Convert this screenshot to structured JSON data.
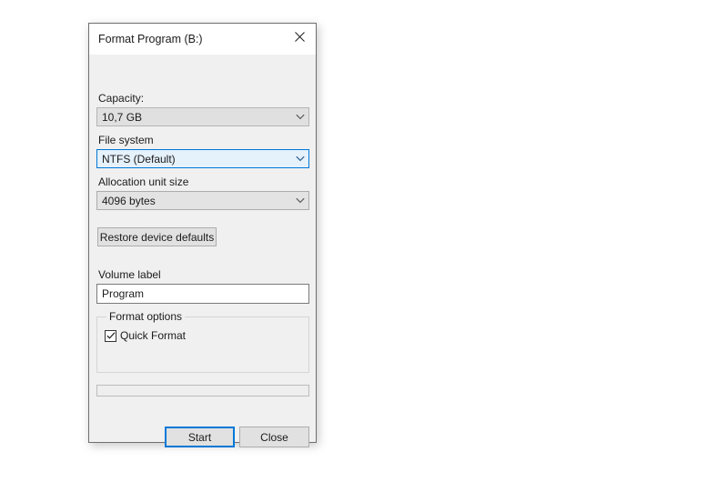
{
  "dialog": {
    "title": "Format Program (B:)",
    "close_icon": "close-icon"
  },
  "capacity": {
    "label": "Capacity:",
    "value": "10,7 GB",
    "arrow_icon": "chevron-down-icon"
  },
  "file_system": {
    "label": "File system",
    "value": "NTFS (Default)",
    "arrow_icon": "chevron-down-icon"
  },
  "allocation_unit": {
    "label": "Allocation unit size",
    "value": "4096 bytes",
    "arrow_icon": "chevron-down-icon"
  },
  "restore_defaults": {
    "label": "Restore device defaults"
  },
  "volume_label": {
    "label": "Volume label",
    "value": "Program",
    "placeholder": ""
  },
  "format_options": {
    "legend": "Format options",
    "quick_format": {
      "label": "Quick Format",
      "checked": true,
      "check_icon": "checkmark-icon"
    }
  },
  "progress": {
    "percent": 0
  },
  "buttons": {
    "start": "Start",
    "close": "Close"
  },
  "colors": {
    "accent": "#0078d7",
    "dialog_bg": "#f0f0f0",
    "titlebar_bg": "#ffffff",
    "focus_fill": "#e5f1fb",
    "border": "#6f6f6f"
  }
}
